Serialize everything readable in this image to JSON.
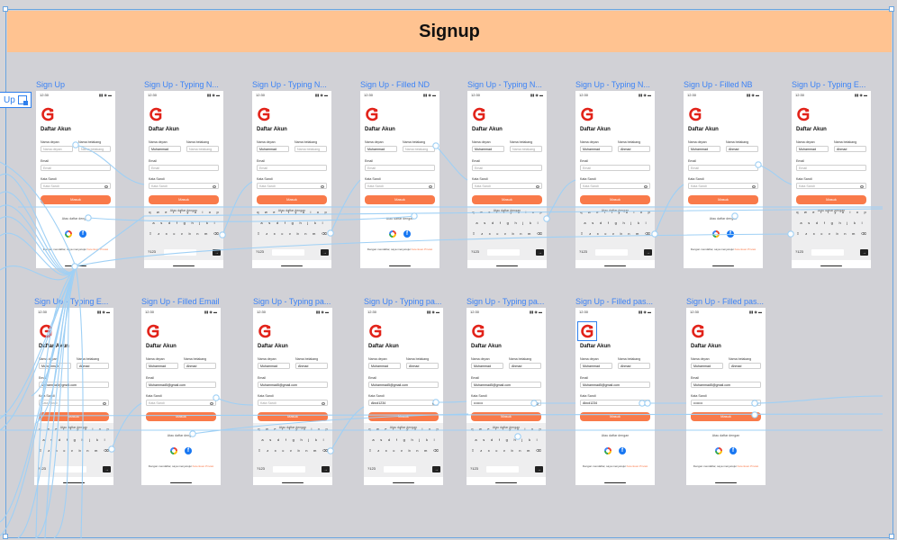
{
  "section": {
    "title": "Signup",
    "flow_start_label": "Up"
  },
  "colors": {
    "banner": "#ffc391",
    "accent": "#f97a4a",
    "wire": "#9fd0f5",
    "label": "#3b82f6"
  },
  "form": {
    "heading": "Daftar Akun",
    "first_name_label": "Nama depan",
    "last_name_label": "Nama belakang",
    "email_label": "Email",
    "password_label": "Kata Sandi",
    "first_name_placeholder": "Nama depan",
    "last_name_placeholder": "Nama belakang",
    "email_placeholder": "Email",
    "password_placeholder": "Kata Sandi",
    "submit": "Masuk",
    "alt_signin": "Atau daftar dengan",
    "terms_prefix": "Dengan mendaftar, saya menyetujui",
    "terms_link": "Ketentuan Privasi",
    "status_time": "12:30",
    "status_icons": "▮▮ ◉ ▬"
  },
  "keyboard": {
    "row1": [
      "q",
      "w",
      "e",
      "r",
      "t",
      "y",
      "u",
      "i",
      "o",
      "p"
    ],
    "row2": [
      "a",
      "s",
      "d",
      "f",
      "g",
      "h",
      "j",
      "k",
      "l"
    ],
    "row3": [
      "⇧",
      "z",
      "x",
      "c",
      "v",
      "b",
      "n",
      "m",
      "⌫"
    ],
    "row4_left": "?123",
    "go": "→"
  },
  "screens": [
    {
      "label": "Sign Up",
      "first": "",
      "last": "",
      "email": "",
      "pass": "",
      "keyboard": false,
      "logo_selected": false
    },
    {
      "label": "Sign Up - Typing N...",
      "first": "Muhammad",
      "last": "",
      "email": "",
      "pass": "",
      "keyboard": true,
      "logo_selected": false
    },
    {
      "label": "Sign Up - Typing N...",
      "first": "Muhammad",
      "last": "",
      "email": "",
      "pass": "",
      "keyboard": true,
      "logo_selected": false
    },
    {
      "label": "Sign Up - Filled ND",
      "first": "Muhammad",
      "last": "",
      "email": "",
      "pass": "",
      "keyboard": false,
      "logo_selected": false
    },
    {
      "label": "Sign Up - Typing N...",
      "first": "Muhammad",
      "last": "",
      "email": "",
      "pass": "",
      "keyboard": true,
      "logo_selected": false
    },
    {
      "label": "Sign Up - Typing N...",
      "first": "Muhammad",
      "last": "Ahmad",
      "email": "",
      "pass": "",
      "keyboard": true,
      "logo_selected": false
    },
    {
      "label": "Sign Up - Filled NB",
      "first": "Muhammad",
      "last": "Ahmad",
      "email": "",
      "pass": "",
      "keyboard": false,
      "logo_selected": false
    },
    {
      "label": "Sign Up - Typing E...",
      "first": "Muhammad",
      "last": "Ahmad",
      "email": "",
      "pass": "",
      "keyboard": true,
      "logo_selected": false
    },
    {
      "label": "Sign Up - Typing E...",
      "first": "Muhammad",
      "last": "Ahmad",
      "email": "Muhammad@gmail.com",
      "pass": "",
      "keyboard": true,
      "logo_selected": false
    },
    {
      "label": "Sign Up - Filled Email",
      "first": "Muhammad",
      "last": "Ahmad",
      "email": "Muhammad5@gmail.com",
      "pass": "",
      "keyboard": false,
      "logo_selected": false
    },
    {
      "label": "Sign Up - Typing pa...",
      "first": "Muhammad",
      "last": "Ahmad",
      "email": "Muhammad5@gmail.com",
      "pass": "",
      "keyboard": true,
      "logo_selected": false
    },
    {
      "label": "Sign Up - Typing pa...",
      "first": "Muhammad",
      "last": "Ahmad",
      "email": "Muhammad5@gmail.com",
      "pass": "Abcd1234",
      "keyboard": true,
      "logo_selected": false
    },
    {
      "label": "Sign Up - Typing pa...",
      "first": "Muhammad",
      "last": "Ahmad",
      "email": "Muhammad5@gmail.com",
      "pass": "••••••••",
      "keyboard": true,
      "logo_selected": false
    },
    {
      "label": "Sign Up - Filled pas...",
      "first": "Muhammad",
      "last": "Ahmad",
      "email": "Muhammad5@gmail.com",
      "pass": "Abcd1234",
      "keyboard": false,
      "logo_selected": true
    },
    {
      "label": "Sign Up - Filled pas...",
      "first": "Muhammad",
      "last": "Ahmad",
      "email": "Muhammad5@gmail.com",
      "pass": "••••••••",
      "keyboard": false,
      "logo_selected": false
    }
  ]
}
